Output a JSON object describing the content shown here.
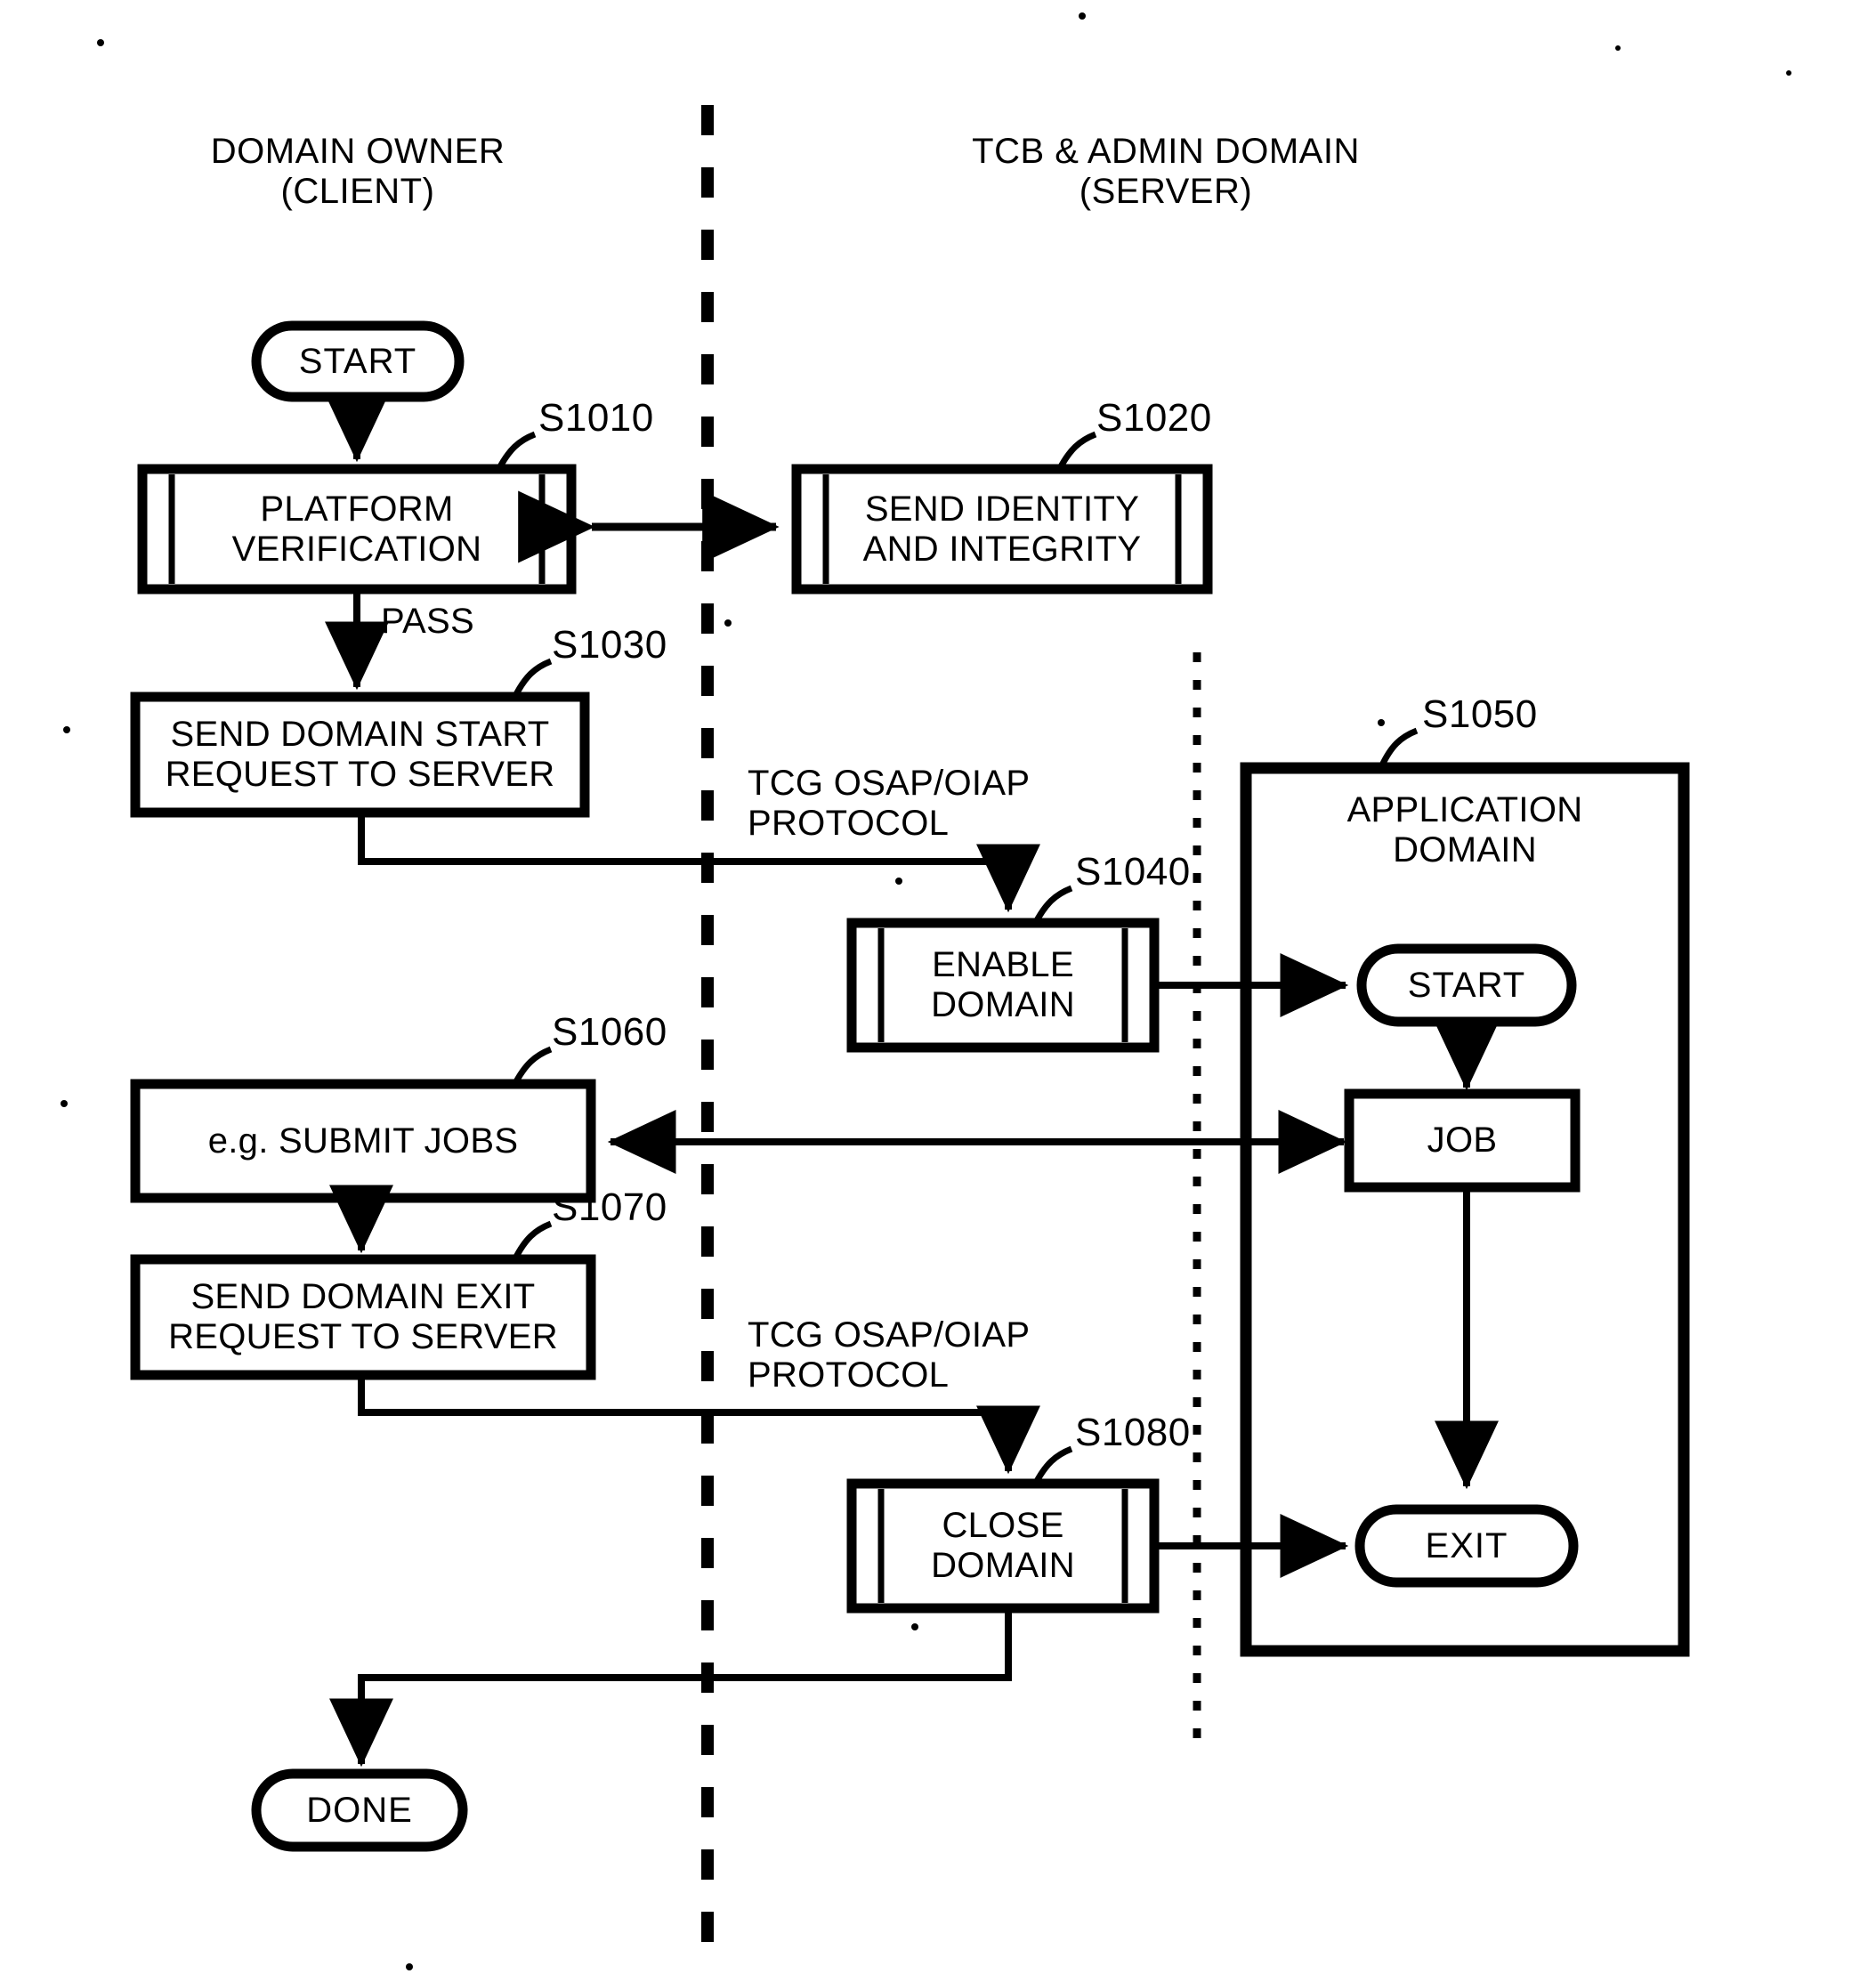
{
  "figure": {
    "type": "patent-flowchart",
    "lanes": [
      {
        "id": "client",
        "title": "DOMAIN OWNER\n(CLIENT)"
      },
      {
        "id": "server",
        "title": "TCB & ADMIN DOMAIN\n(SERVER)"
      }
    ],
    "terminators": [
      {
        "id": "start-client",
        "label": "START"
      },
      {
        "id": "done-client",
        "label": "DONE"
      },
      {
        "id": "start-app",
        "label": "START"
      },
      {
        "id": "exit-app",
        "label": "EXIT"
      }
    ],
    "nodes": [
      {
        "id": "s1010",
        "ref": "S1010",
        "label": "PLATFORM\nVERIFICATION",
        "style": "predefined-process"
      },
      {
        "id": "s1020",
        "ref": "S1020",
        "label": "SEND IDENTITY\nAND INTEGRITY",
        "style": "predefined-process"
      },
      {
        "id": "s1030",
        "ref": "S1030",
        "label": "SEND DOMAIN START\nREQUEST TO SERVER",
        "style": "process"
      },
      {
        "id": "s1040",
        "ref": "S1040",
        "label": "ENABLE\nDOMAIN",
        "style": "predefined-process"
      },
      {
        "id": "s1050",
        "ref": "S1050",
        "label": "APPLICATION\nDOMAIN",
        "style": "container"
      },
      {
        "id": "s1060",
        "ref": "S1060",
        "label": "e.g. SUBMIT JOBS",
        "style": "process"
      },
      {
        "id": "s1070",
        "ref": "S1070",
        "label": "SEND DOMAIN EXIT\nREQUEST TO SERVER",
        "style": "process"
      },
      {
        "id": "s1080",
        "ref": "S1080",
        "label": "CLOSE\nDOMAIN",
        "style": "predefined-process"
      },
      {
        "id": "job",
        "ref": "",
        "label": "JOB",
        "style": "process"
      }
    ],
    "edge_labels": [
      {
        "id": "pass",
        "label": "PASS"
      },
      {
        "id": "proto-1",
        "label": "TCG OSAP/OIAP\nPROTOCOL"
      },
      {
        "id": "proto-2",
        "label": "TCG OSAP/OIAP\nPROTOCOL"
      }
    ],
    "colors": {
      "ink": "#000000",
      "paper": "#ffffff"
    }
  }
}
